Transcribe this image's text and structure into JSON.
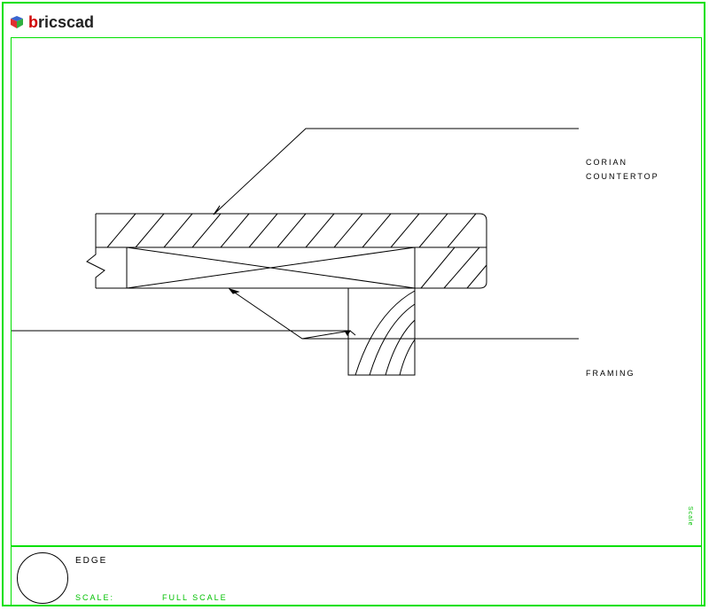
{
  "app": {
    "logo_text_b": "b",
    "logo_text_rest": "ricscad"
  },
  "annotations": {
    "corian_line1": "CORIAN",
    "corian_line2": "COUNTERTOP",
    "framing": "FRAMING"
  },
  "title_block": {
    "name": "EDGE",
    "scale_label": "SCALE:",
    "scale_value": "FULL SCALE"
  },
  "side_text": "Scale"
}
